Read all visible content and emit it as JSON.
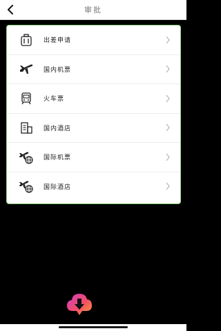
{
  "nav": {
    "title": "审批"
  },
  "menu": {
    "items": [
      {
        "label": "出差申请",
        "icon": "suitcase-icon"
      },
      {
        "label": "国内机票",
        "icon": "airplane-icon"
      },
      {
        "label": "火车票",
        "icon": "train-icon"
      },
      {
        "label": "国内酒店",
        "icon": "building-icon"
      },
      {
        "label": "国际机票",
        "icon": "international-flight-icon"
      },
      {
        "label": "国际酒店",
        "icon": "international-hotel-icon"
      }
    ]
  },
  "colors": {
    "card_border": "#8fd27f",
    "background": "#000000",
    "nav_bg": "#ffffff"
  }
}
